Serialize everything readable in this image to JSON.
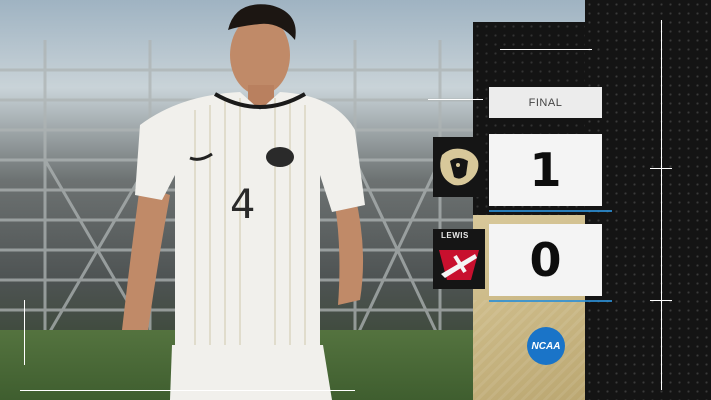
{
  "status": "FINAL",
  "home": {
    "score": "1",
    "logo": "lion-head-logo"
  },
  "away": {
    "score": "0",
    "logo": "lewis-flyers-logo",
    "logo_text": "LEWIS"
  },
  "player": {
    "number": "4"
  },
  "footer_logo": {
    "text": "NCAA",
    "color": "#1a74c8"
  },
  "colors": {
    "gold": "#cdbb89",
    "dark": "#141414",
    "accent": "#2b8fd6"
  }
}
